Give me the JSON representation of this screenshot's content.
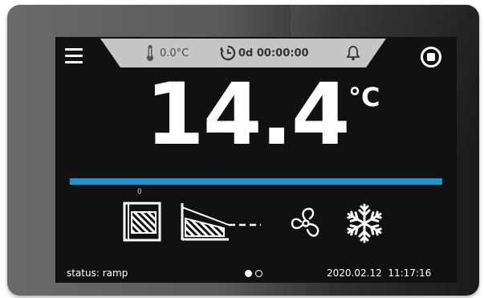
{
  "status_strip": {
    "chamber_temp": "0.0°C",
    "timer": "0d 00:00:00"
  },
  "main": {
    "temperature": "14.4",
    "unit": "°C",
    "progress": 1.0,
    "step_number": "0"
  },
  "icons": {
    "menu": "menu-icon",
    "thermometer": "thermometer-icon",
    "timer": "timer-icon",
    "alarm": "bell-icon",
    "stop": "stop-icon",
    "heating": "heating-icon",
    "ramp": "ramp-icon",
    "fan": "fan-icon",
    "cooling": "snowflake-icon"
  },
  "footer": {
    "status": "status: ramp",
    "date": "2020.02.12",
    "time": "11:17:16",
    "pages": [
      true,
      false
    ]
  },
  "colors": {
    "accent": "#1e96d4",
    "screen": "#111112",
    "strip": "#c6c6c6"
  }
}
